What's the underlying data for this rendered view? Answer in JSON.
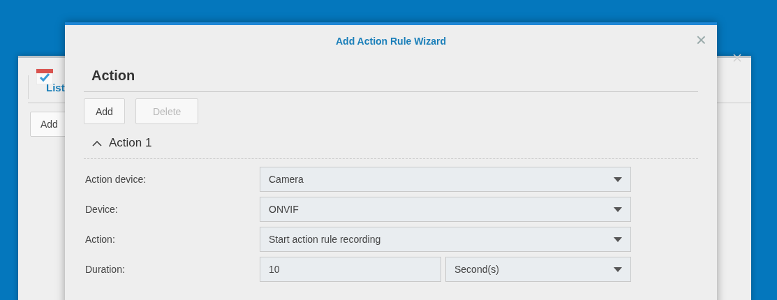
{
  "back_window": {
    "tabs": [
      {
        "label": "List",
        "selected": true
      }
    ],
    "buttons": [
      "Add"
    ]
  },
  "dialog": {
    "title": "Add Action Rule Wizard",
    "close": "×",
    "heading": "Action",
    "toolbar": [
      {
        "label": "Add",
        "disabled": false
      },
      {
        "label": "Delete",
        "disabled": true
      }
    ],
    "section": {
      "title": "Action 1",
      "expanded": true,
      "fields": [
        {
          "label": "Action device:",
          "kind": "select",
          "value": "Camera"
        },
        {
          "label": "Device:",
          "kind": "select",
          "value": "ONVIF"
        },
        {
          "label": "Action:",
          "kind": "select",
          "value": "Start action rule recording"
        },
        {
          "label": "Duration:",
          "kind": "input-select",
          "value": "10",
          "unit": "Second(s)"
        }
      ]
    }
  }
}
